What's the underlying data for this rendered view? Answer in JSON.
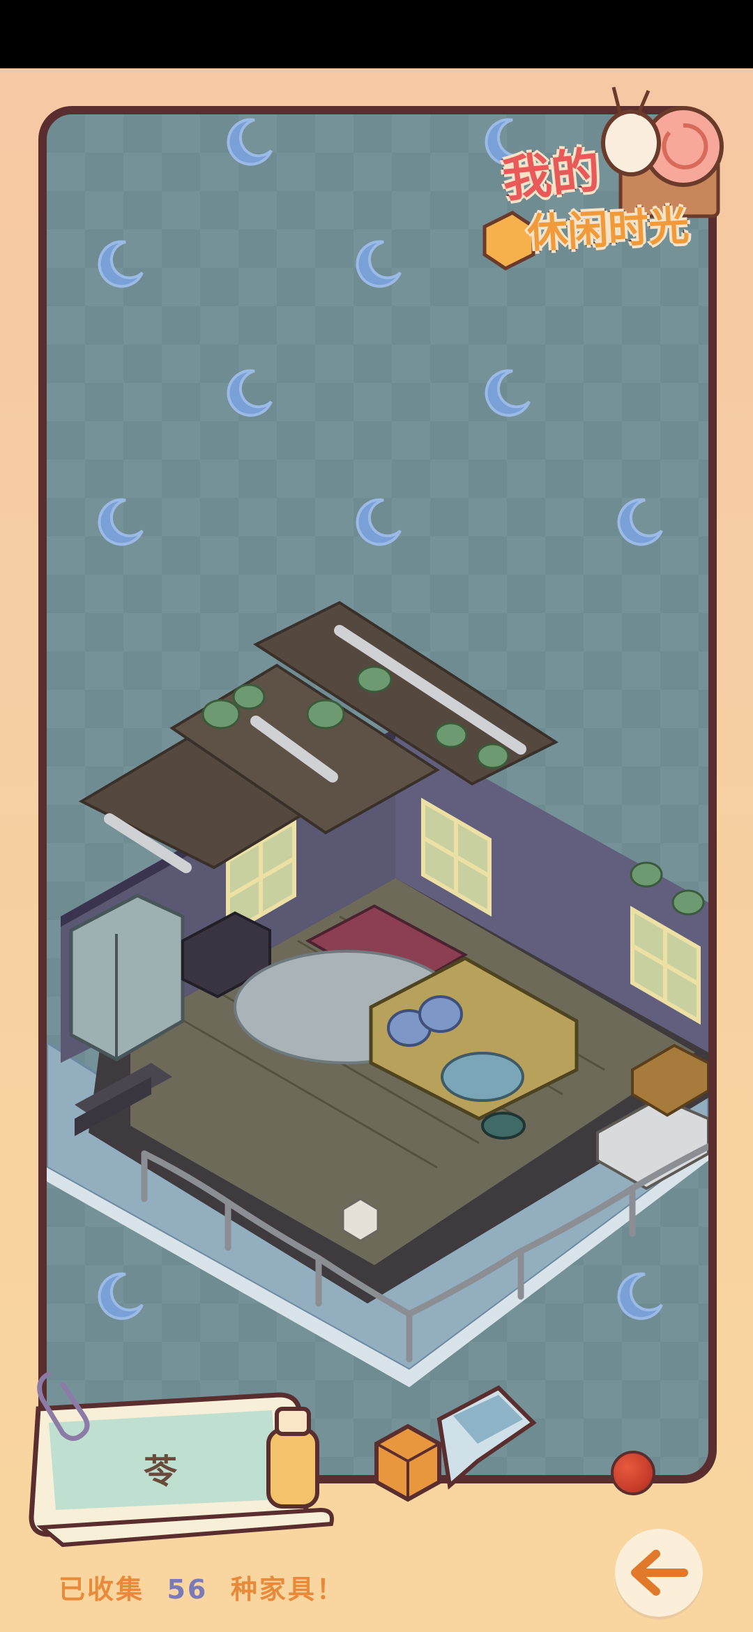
{
  "scene": {
    "game_title_line1": "我的",
    "game_title_line2": "休闲时光",
    "room_name": "苓",
    "collected_prefix": "已收集",
    "collected_count": "56",
    "collected_suffix": "种家具！"
  },
  "colors": {
    "background": "#f7cfa3",
    "frame_border": "#5a2e2e",
    "frame_fill": "#6f8c93",
    "moon": "#7aa0d8",
    "count_text": "#e98a3a",
    "count_number": "#7a7ab8",
    "back_arrow": "#e07a2a"
  },
  "icons": {
    "moon": "moon-icon",
    "back": "arrow-left-icon",
    "logo_snail": "snail-icon",
    "paperclip": "paperclip-icon"
  }
}
